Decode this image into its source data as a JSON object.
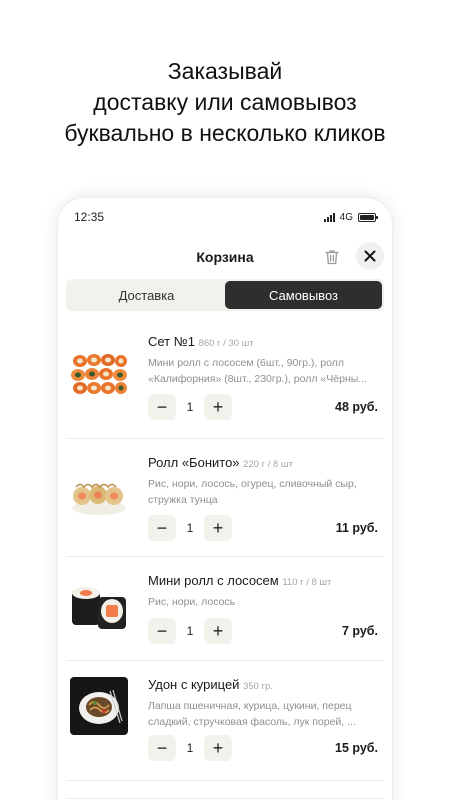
{
  "headline": {
    "line1": "Заказывай",
    "line2": "доставку или самовывоз",
    "line3": "буквально в несколько кликов"
  },
  "status_bar": {
    "time": "12:35",
    "network": "4G"
  },
  "cart": {
    "title": "Корзина",
    "tabs": [
      {
        "label": "Доставка",
        "active": false
      },
      {
        "label": "Самовывоз",
        "active": true
      }
    ],
    "items": [
      {
        "name": "Сет №1",
        "meta": "860 г / 30 шт",
        "description": "Мини ролл с лососем (6шт., 90гр.), ролл «Калифорния» (8шт., 230гр.), ролл «Чёрны...",
        "quantity": "1",
        "price": "48 руб."
      },
      {
        "name": "Ролл «Бонито»",
        "meta": "220 г / 8 шт",
        "description": "Рис, нори, лосось, огурец, сливочный сыр, стружка тунца",
        "quantity": "1",
        "price": "11 руб."
      },
      {
        "name": "Мини ролл с лососем",
        "meta": "110 г / 8 шт",
        "description": "Рис, нори, лосось",
        "quantity": "1",
        "price": "7 руб."
      },
      {
        "name": "Удон с курицей",
        "meta": "350 гр.",
        "description": "Лапша пшеничная, курица, цукини, перец сладкий, стручковая фасоль, лук порей, ...",
        "quantity": "1",
        "price": "15 руб."
      }
    ],
    "stepper": {
      "minus": "−",
      "plus": "+"
    }
  },
  "icons": {
    "trash": "trash-icon",
    "close": "close-icon",
    "signal": "signal-icon",
    "battery": "battery-icon"
  },
  "colors": {
    "active_tab": "#2e2e2e",
    "segment_bg": "#f2f1ec",
    "muted_text": "#8f8f8f"
  }
}
